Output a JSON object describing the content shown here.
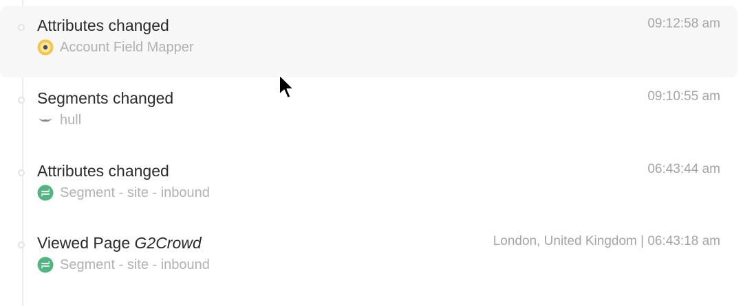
{
  "events": [
    {
      "title": "Attributes changed",
      "title_detail": "",
      "source": "Account Field Mapper",
      "source_icon": "account-field-mapper-icon",
      "meta": "09:12:58 am"
    },
    {
      "title": "Segments changed",
      "title_detail": "",
      "source": "hull",
      "source_icon": "hull-logo-icon",
      "meta": "09:10:55 am"
    },
    {
      "title": "Attributes changed",
      "title_detail": "",
      "source": "Segment - site - inbound",
      "source_icon": "segment-logo-icon",
      "meta": "06:43:44 am"
    },
    {
      "title": "Viewed Page",
      "title_detail": "G2Crowd",
      "source": "Segment - site - inbound",
      "source_icon": "segment-logo-icon",
      "meta": "London, United Kingdom | 06:43:18 am"
    }
  ],
  "colors": {
    "hover_bg": "#f7f7f7",
    "segment_green": "#52b581",
    "mapper_yellow": "#f3c64a"
  }
}
